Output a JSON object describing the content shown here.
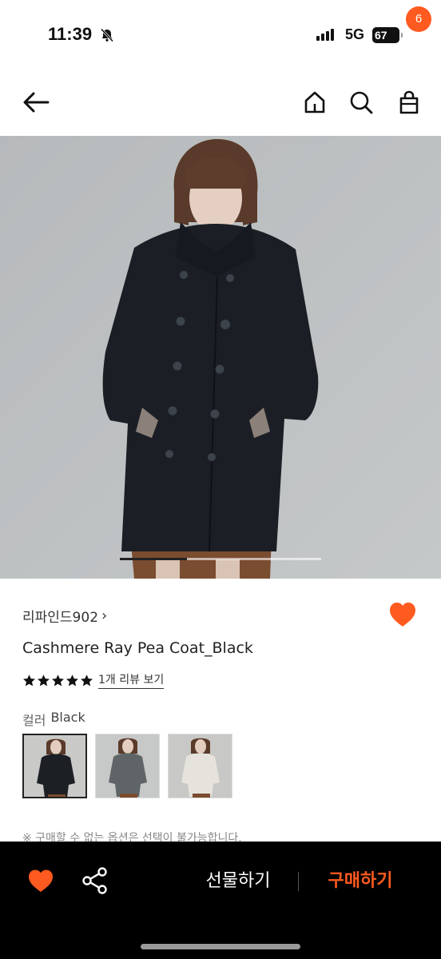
{
  "status_bar": {
    "time": "11:39",
    "network": "5G",
    "battery": "67"
  },
  "nav": {
    "cart_count": "6"
  },
  "hero": {
    "current_slide": 1,
    "total_slides": 3
  },
  "product": {
    "brand": "리파인드902",
    "brand_chevron": "›",
    "title": "Cashmere Ray Pea Coat_Black",
    "rating": 5,
    "review_link": "1개 리뷰 보기",
    "wishlisted": true
  },
  "options": {
    "label": "컬러",
    "selected_value": "Black",
    "swatches": [
      {
        "name": "Black",
        "color": "#1c1f24",
        "bg": "#c9c9c8"
      },
      {
        "name": "Gray",
        "color": "#5f6466",
        "bg": "#c7c8c8"
      },
      {
        "name": "Ivory",
        "color": "#e6e3dc",
        "bg": "#c8c8c6"
      }
    ]
  },
  "notice": "※ 구매할 수 없는 옵션은 선택이 불가능합니다.",
  "bottom_bar": {
    "gift_label": "선물하기",
    "buy_label": "구매하기"
  },
  "colors": {
    "accent": "#ff5a1f",
    "bottom_bar_bg": "#000000"
  }
}
